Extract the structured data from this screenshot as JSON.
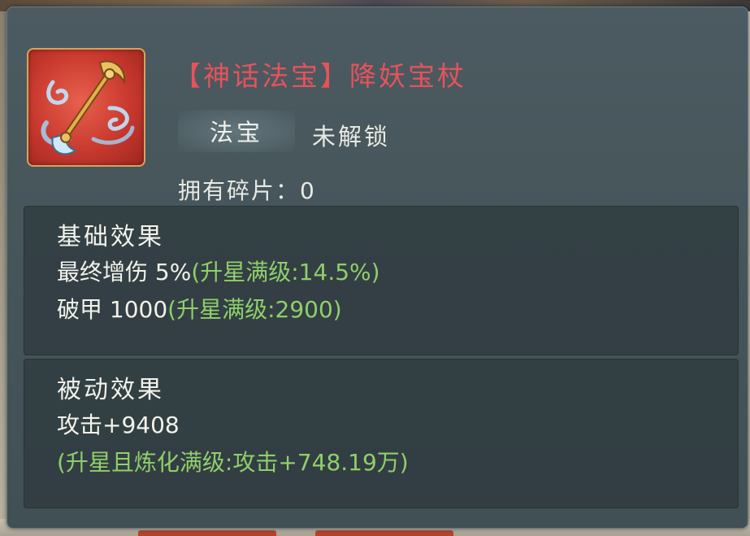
{
  "item": {
    "icon": "staff-icon",
    "title_open": "【",
    "title_category": "神话法宝",
    "title_close": "】",
    "title_name": "降妖宝杖",
    "tag": "法宝",
    "lock_status": "未解锁",
    "fragments_label": "拥有碎片：",
    "fragments_value": "0"
  },
  "basic_effects": {
    "heading": "基础效果",
    "rows": [
      {
        "label": "最终增伤 5%",
        "max": "(升星满级:14.5%)"
      },
      {
        "label": "破甲 1000",
        "max": "(升星满级:2900)"
      }
    ]
  },
  "passive_effects": {
    "heading": "被动效果",
    "value": "攻击+9408",
    "max": "(升星且炼化满级:攻击+748.19万)"
  },
  "colors": {
    "title": "#e8525b",
    "max_text": "#8fcf6a",
    "panel": "#46565b",
    "icon_bg": "#c8392e",
    "icon_border": "#d6a35a"
  }
}
